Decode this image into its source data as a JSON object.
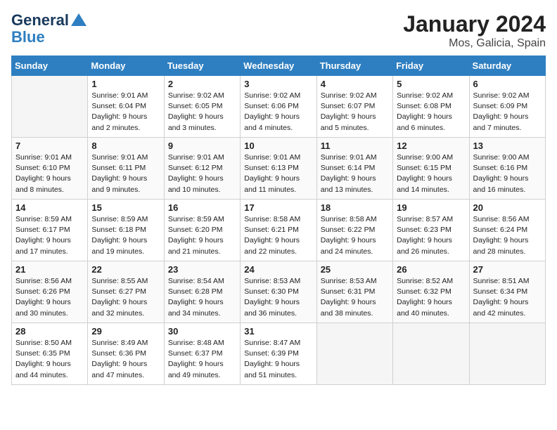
{
  "header": {
    "logo_line1": "General",
    "logo_line2": "Blue",
    "month": "January 2024",
    "location": "Mos, Galicia, Spain"
  },
  "weekdays": [
    "Sunday",
    "Monday",
    "Tuesday",
    "Wednesday",
    "Thursday",
    "Friday",
    "Saturday"
  ],
  "weeks": [
    [
      {
        "day": "",
        "empty": true
      },
      {
        "day": "1",
        "sunrise": "Sunrise: 9:01 AM",
        "sunset": "Sunset: 6:04 PM",
        "daylight": "Daylight: 9 hours and 2 minutes."
      },
      {
        "day": "2",
        "sunrise": "Sunrise: 9:02 AM",
        "sunset": "Sunset: 6:05 PM",
        "daylight": "Daylight: 9 hours and 3 minutes."
      },
      {
        "day": "3",
        "sunrise": "Sunrise: 9:02 AM",
        "sunset": "Sunset: 6:06 PM",
        "daylight": "Daylight: 9 hours and 4 minutes."
      },
      {
        "day": "4",
        "sunrise": "Sunrise: 9:02 AM",
        "sunset": "Sunset: 6:07 PM",
        "daylight": "Daylight: 9 hours and 5 minutes."
      },
      {
        "day": "5",
        "sunrise": "Sunrise: 9:02 AM",
        "sunset": "Sunset: 6:08 PM",
        "daylight": "Daylight: 9 hours and 6 minutes."
      },
      {
        "day": "6",
        "sunrise": "Sunrise: 9:02 AM",
        "sunset": "Sunset: 6:09 PM",
        "daylight": "Daylight: 9 hours and 7 minutes."
      }
    ],
    [
      {
        "day": "7",
        "sunrise": "Sunrise: 9:01 AM",
        "sunset": "Sunset: 6:10 PM",
        "daylight": "Daylight: 9 hours and 8 minutes."
      },
      {
        "day": "8",
        "sunrise": "Sunrise: 9:01 AM",
        "sunset": "Sunset: 6:11 PM",
        "daylight": "Daylight: 9 hours and 9 minutes."
      },
      {
        "day": "9",
        "sunrise": "Sunrise: 9:01 AM",
        "sunset": "Sunset: 6:12 PM",
        "daylight": "Daylight: 9 hours and 10 minutes."
      },
      {
        "day": "10",
        "sunrise": "Sunrise: 9:01 AM",
        "sunset": "Sunset: 6:13 PM",
        "daylight": "Daylight: 9 hours and 11 minutes."
      },
      {
        "day": "11",
        "sunrise": "Sunrise: 9:01 AM",
        "sunset": "Sunset: 6:14 PM",
        "daylight": "Daylight: 9 hours and 13 minutes."
      },
      {
        "day": "12",
        "sunrise": "Sunrise: 9:00 AM",
        "sunset": "Sunset: 6:15 PM",
        "daylight": "Daylight: 9 hours and 14 minutes."
      },
      {
        "day": "13",
        "sunrise": "Sunrise: 9:00 AM",
        "sunset": "Sunset: 6:16 PM",
        "daylight": "Daylight: 9 hours and 16 minutes."
      }
    ],
    [
      {
        "day": "14",
        "sunrise": "Sunrise: 8:59 AM",
        "sunset": "Sunset: 6:17 PM",
        "daylight": "Daylight: 9 hours and 17 minutes."
      },
      {
        "day": "15",
        "sunrise": "Sunrise: 8:59 AM",
        "sunset": "Sunset: 6:18 PM",
        "daylight": "Daylight: 9 hours and 19 minutes."
      },
      {
        "day": "16",
        "sunrise": "Sunrise: 8:59 AM",
        "sunset": "Sunset: 6:20 PM",
        "daylight": "Daylight: 9 hours and 21 minutes."
      },
      {
        "day": "17",
        "sunrise": "Sunrise: 8:58 AM",
        "sunset": "Sunset: 6:21 PM",
        "daylight": "Daylight: 9 hours and 22 minutes."
      },
      {
        "day": "18",
        "sunrise": "Sunrise: 8:58 AM",
        "sunset": "Sunset: 6:22 PM",
        "daylight": "Daylight: 9 hours and 24 minutes."
      },
      {
        "day": "19",
        "sunrise": "Sunrise: 8:57 AM",
        "sunset": "Sunset: 6:23 PM",
        "daylight": "Daylight: 9 hours and 26 minutes."
      },
      {
        "day": "20",
        "sunrise": "Sunrise: 8:56 AM",
        "sunset": "Sunset: 6:24 PM",
        "daylight": "Daylight: 9 hours and 28 minutes."
      }
    ],
    [
      {
        "day": "21",
        "sunrise": "Sunrise: 8:56 AM",
        "sunset": "Sunset: 6:26 PM",
        "daylight": "Daylight: 9 hours and 30 minutes."
      },
      {
        "day": "22",
        "sunrise": "Sunrise: 8:55 AM",
        "sunset": "Sunset: 6:27 PM",
        "daylight": "Daylight: 9 hours and 32 minutes."
      },
      {
        "day": "23",
        "sunrise": "Sunrise: 8:54 AM",
        "sunset": "Sunset: 6:28 PM",
        "daylight": "Daylight: 9 hours and 34 minutes."
      },
      {
        "day": "24",
        "sunrise": "Sunrise: 8:53 AM",
        "sunset": "Sunset: 6:30 PM",
        "daylight": "Daylight: 9 hours and 36 minutes."
      },
      {
        "day": "25",
        "sunrise": "Sunrise: 8:53 AM",
        "sunset": "Sunset: 6:31 PM",
        "daylight": "Daylight: 9 hours and 38 minutes."
      },
      {
        "day": "26",
        "sunrise": "Sunrise: 8:52 AM",
        "sunset": "Sunset: 6:32 PM",
        "daylight": "Daylight: 9 hours and 40 minutes."
      },
      {
        "day": "27",
        "sunrise": "Sunrise: 8:51 AM",
        "sunset": "Sunset: 6:34 PM",
        "daylight": "Daylight: 9 hours and 42 minutes."
      }
    ],
    [
      {
        "day": "28",
        "sunrise": "Sunrise: 8:50 AM",
        "sunset": "Sunset: 6:35 PM",
        "daylight": "Daylight: 9 hours and 44 minutes."
      },
      {
        "day": "29",
        "sunrise": "Sunrise: 8:49 AM",
        "sunset": "Sunset: 6:36 PM",
        "daylight": "Daylight: 9 hours and 47 minutes."
      },
      {
        "day": "30",
        "sunrise": "Sunrise: 8:48 AM",
        "sunset": "Sunset: 6:37 PM",
        "daylight": "Daylight: 9 hours and 49 minutes."
      },
      {
        "day": "31",
        "sunrise": "Sunrise: 8:47 AM",
        "sunset": "Sunset: 6:39 PM",
        "daylight": "Daylight: 9 hours and 51 minutes."
      },
      {
        "day": "",
        "empty": true
      },
      {
        "day": "",
        "empty": true
      },
      {
        "day": "",
        "empty": true
      }
    ]
  ]
}
